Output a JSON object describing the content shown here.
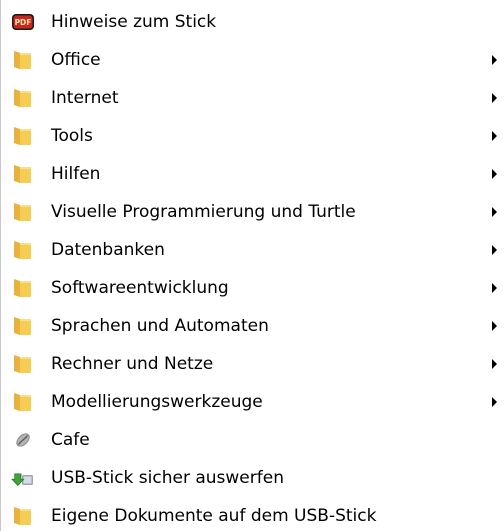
{
  "menu": {
    "items": [
      {
        "label": "Hinweise zum Stick",
        "icon": "pdf-icon",
        "submenu": false
      },
      {
        "label": "Office",
        "icon": "folder-icon",
        "submenu": true
      },
      {
        "label": "Internet",
        "icon": "folder-icon",
        "submenu": true
      },
      {
        "label": "Tools",
        "icon": "folder-icon",
        "submenu": true
      },
      {
        "label": "Hilfen",
        "icon": "folder-icon",
        "submenu": true
      },
      {
        "label": "Visuelle Programmierung und Turtle",
        "icon": "folder-icon",
        "submenu": true
      },
      {
        "label": "Datenbanken",
        "icon": "folder-icon",
        "submenu": true
      },
      {
        "label": "Softwareentwicklung",
        "icon": "folder-icon",
        "submenu": true
      },
      {
        "label": "Sprachen und Automaten",
        "icon": "folder-icon",
        "submenu": true
      },
      {
        "label": "Rechner und Netze",
        "icon": "folder-icon",
        "submenu": true
      },
      {
        "label": "Modellierungswerkzeuge",
        "icon": "folder-icon",
        "submenu": true
      },
      {
        "label": "Cafe",
        "icon": "coffee-bean-icon",
        "submenu": false
      },
      {
        "label": "USB-Stick sicher auswerfen",
        "icon": "eject-usb-icon",
        "submenu": false
      },
      {
        "label": "Eigene Dokumente auf dem USB-Stick",
        "icon": "folder-icon",
        "submenu": false
      }
    ],
    "pdf_badge_text": "PDF"
  },
  "colors": {
    "folder_yellow": "#f4cd52",
    "folder_dark": "#c9952b",
    "pdf_red": "#c8271f",
    "eject_green": "#3fa23b",
    "submenu_arrow": "#000000",
    "background": "#ffffff"
  }
}
